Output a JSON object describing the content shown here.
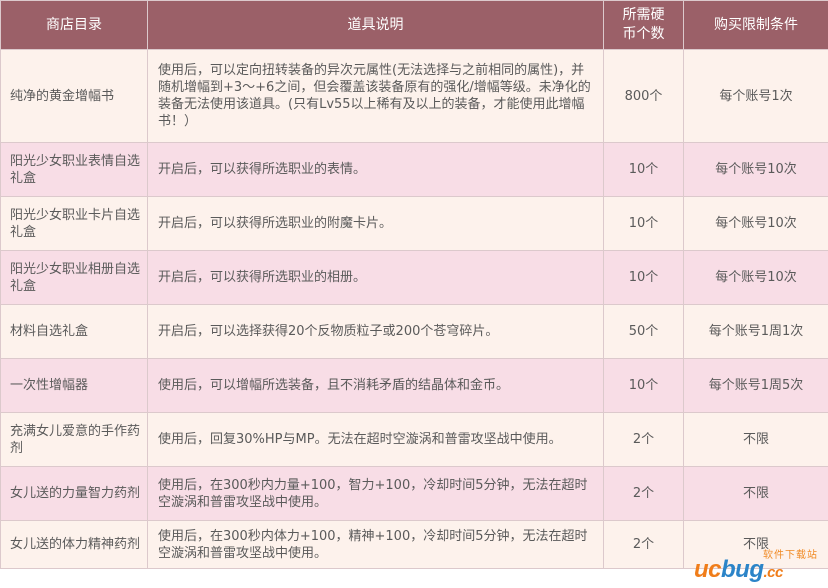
{
  "table": {
    "headers": {
      "name": "商店目录",
      "desc": "道具说明",
      "coins": "所需硬币个数",
      "limit": "购买限制条件"
    },
    "rows": [
      {
        "name": "纯净的黄金增幅书",
        "desc": "使用后，可以定向扭转装备的异次元属性(无法选择与之前相同的属性)，并随机增幅到+3～+6之间，但会覆盖该装备原有的强化/增幅等级。未净化的装备无法使用该道具。(只有Lv55以上稀有及以上的装备，才能使用此增幅书！）",
        "coins": "800个",
        "limit": "每个账号1次"
      },
      {
        "name": "阳光少女职业表情自选礼盒",
        "desc": "开启后，可以获得所选职业的表情。",
        "coins": "10个",
        "limit": "每个账号10次"
      },
      {
        "name": "阳光少女职业卡片自选礼盒",
        "desc": "开启后，可以获得所选职业的附魔卡片。",
        "coins": "10个",
        "limit": "每个账号10次"
      },
      {
        "name": "阳光少女职业相册自选礼盒",
        "desc": "开启后，可以获得所选职业的相册。",
        "coins": "10个",
        "limit": "每个账号10次"
      },
      {
        "name": "材料自选礼盒",
        "desc": "开启后，可以选择获得20个反物质粒子或200个苍穹碎片。",
        "coins": "50个",
        "limit": "每个账号1周1次"
      },
      {
        "name": "一次性增幅器",
        "desc": "使用后，可以增幅所选装备，且不消耗矛盾的结晶体和金币。",
        "coins": "10个",
        "limit": "每个账号1周5次"
      },
      {
        "name": "充满女儿爱意的手作药剂",
        "desc": "使用后，回复30%HP与MP。无法在超时空漩涡和普雷攻坚战中使用。",
        "coins": "2个",
        "limit": "不限"
      },
      {
        "name": "女儿送的力量智力药剂",
        "desc": "使用后，在300秒内力量+100，智力+100，冷却时间5分钟，无法在超时空漩涡和普雷攻坚战中使用。",
        "coins": "2个",
        "limit": "不限"
      },
      {
        "name": "女儿送的体力精神药剂",
        "desc": "使用后，在300秒内体力+100，精神+100，冷却时间5分钟，无法在超时空漩涡和普雷攻坚战中使用。",
        "coins": "2个",
        "limit": "不限"
      }
    ]
  },
  "watermark": {
    "top": "软件下载站",
    "main_a": "uc",
    "main_b": "bug",
    "main_c": ".cc"
  },
  "colors": {
    "header_bg": "#9b6068",
    "row_odd": "#fdf2ec",
    "row_even": "#f8dde6",
    "border": "#dcc9cc"
  }
}
